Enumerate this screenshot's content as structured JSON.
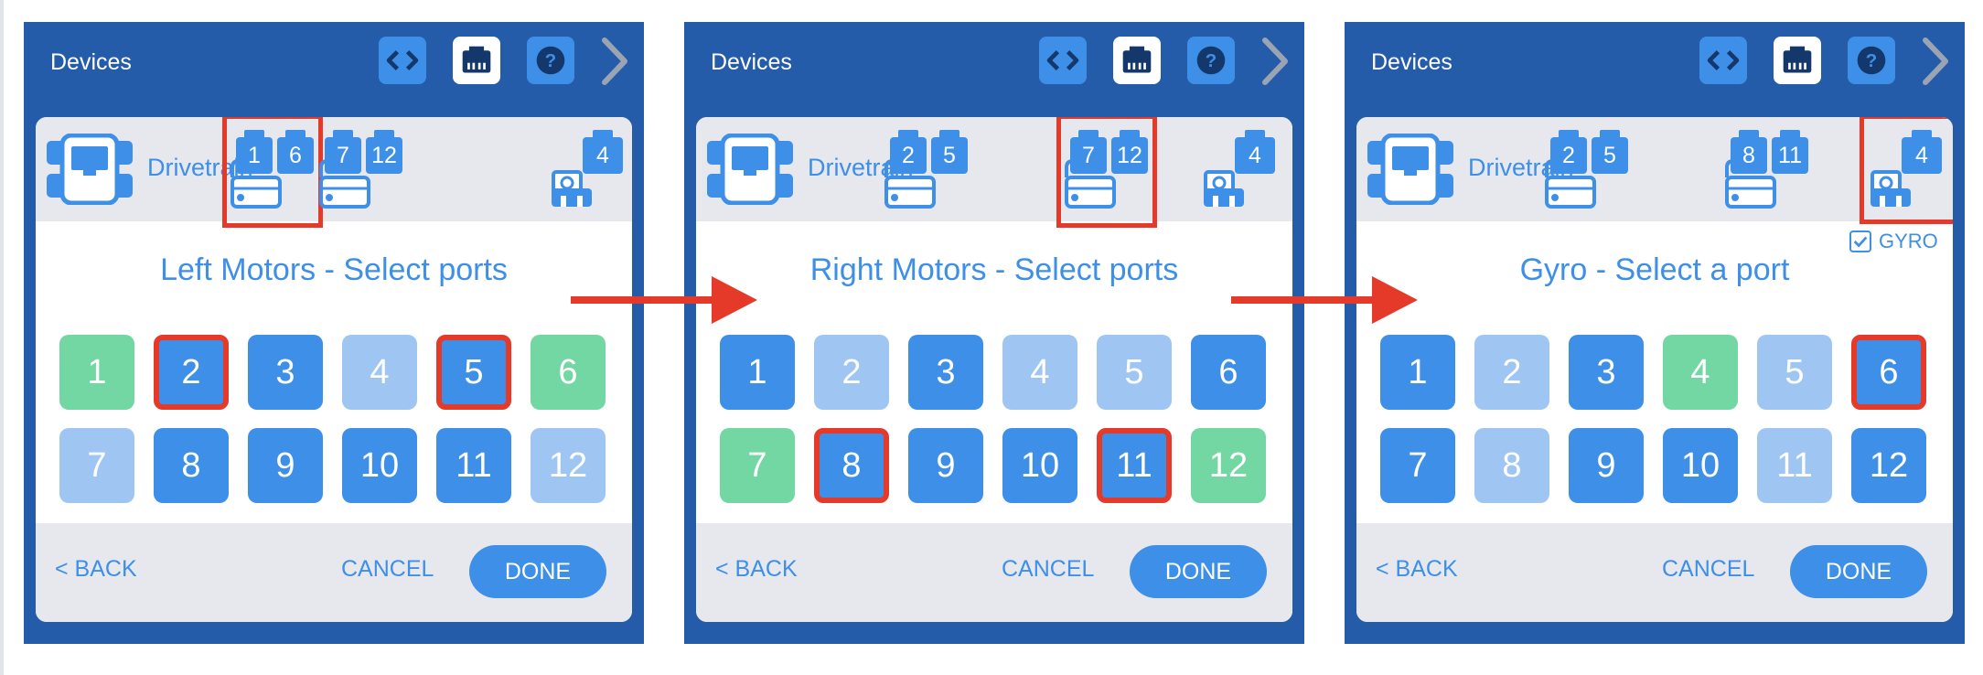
{
  "accent_color": "#3d8fe8",
  "highlight_color": "#e53a2a",
  "arrows": [
    "right-arrow",
    "right-arrow"
  ],
  "panels": [
    {
      "header": {
        "title": "Devices",
        "icons": [
          "code-icon",
          "devices-icon",
          "help-icon",
          "chevron-right-icon"
        ]
      },
      "drivetrain_label": "Drivetrain",
      "motor_groups": [
        {
          "ports": [
            "1",
            "6"
          ],
          "highlighted": true
        },
        {
          "ports": [
            "7",
            "12"
          ],
          "highlighted": false
        }
      ],
      "gyro_device": {
        "port": "4",
        "highlighted": false
      },
      "gyro_checkbox": null,
      "prompt": "Left Motors - Select ports",
      "ports": [
        {
          "n": "1",
          "state": "chosen"
        },
        {
          "n": "2",
          "state": "selected"
        },
        {
          "n": "3",
          "state": "available"
        },
        {
          "n": "4",
          "state": "used"
        },
        {
          "n": "5",
          "state": "selected"
        },
        {
          "n": "6",
          "state": "chosen"
        },
        {
          "n": "7",
          "state": "used"
        },
        {
          "n": "8",
          "state": "available"
        },
        {
          "n": "9",
          "state": "available"
        },
        {
          "n": "10",
          "state": "available"
        },
        {
          "n": "11",
          "state": "available"
        },
        {
          "n": "12",
          "state": "used"
        }
      ],
      "footer": {
        "back": "< BACK",
        "cancel": "CANCEL",
        "done": "DONE"
      }
    },
    {
      "header": {
        "title": "Devices",
        "icons": [
          "code-icon",
          "devices-icon",
          "help-icon",
          "chevron-right-icon"
        ]
      },
      "drivetrain_label": "Drivetrain",
      "motor_groups": [
        {
          "ports": [
            "2",
            "5"
          ],
          "highlighted": false
        },
        {
          "ports": [
            "7",
            "12"
          ],
          "highlighted": true
        }
      ],
      "gyro_device": {
        "port": "4",
        "highlighted": false
      },
      "gyro_checkbox": null,
      "prompt": "Right Motors - Select ports",
      "ports": [
        {
          "n": "1",
          "state": "available"
        },
        {
          "n": "2",
          "state": "used"
        },
        {
          "n": "3",
          "state": "available"
        },
        {
          "n": "4",
          "state": "used"
        },
        {
          "n": "5",
          "state": "used"
        },
        {
          "n": "6",
          "state": "available"
        },
        {
          "n": "7",
          "state": "chosen"
        },
        {
          "n": "8",
          "state": "selected"
        },
        {
          "n": "9",
          "state": "available"
        },
        {
          "n": "10",
          "state": "available"
        },
        {
          "n": "11",
          "state": "selected"
        },
        {
          "n": "12",
          "state": "chosen"
        }
      ],
      "footer": {
        "back": "< BACK",
        "cancel": "CANCEL",
        "done": "DONE"
      }
    },
    {
      "header": {
        "title": "Devices",
        "icons": [
          "code-icon",
          "devices-icon",
          "help-icon",
          "chevron-right-icon"
        ]
      },
      "drivetrain_label": "Drivetrain",
      "motor_groups": [
        {
          "ports": [
            "2",
            "5"
          ],
          "highlighted": false
        },
        {
          "ports": [
            "8",
            "11"
          ],
          "highlighted": false
        }
      ],
      "gyro_device": {
        "port": "4",
        "highlighted": true
      },
      "gyro_checkbox": {
        "label": "GYRO",
        "checked": true
      },
      "prompt": "Gyro - Select a port",
      "ports": [
        {
          "n": "1",
          "state": "available"
        },
        {
          "n": "2",
          "state": "used"
        },
        {
          "n": "3",
          "state": "available"
        },
        {
          "n": "4",
          "state": "chosen"
        },
        {
          "n": "5",
          "state": "used"
        },
        {
          "n": "6",
          "state": "selected"
        },
        {
          "n": "7",
          "state": "available"
        },
        {
          "n": "8",
          "state": "used"
        },
        {
          "n": "9",
          "state": "available"
        },
        {
          "n": "10",
          "state": "available"
        },
        {
          "n": "11",
          "state": "used"
        },
        {
          "n": "12",
          "state": "available"
        }
      ],
      "footer": {
        "back": "< BACK",
        "cancel": "CANCEL",
        "done": "DONE"
      }
    }
  ]
}
